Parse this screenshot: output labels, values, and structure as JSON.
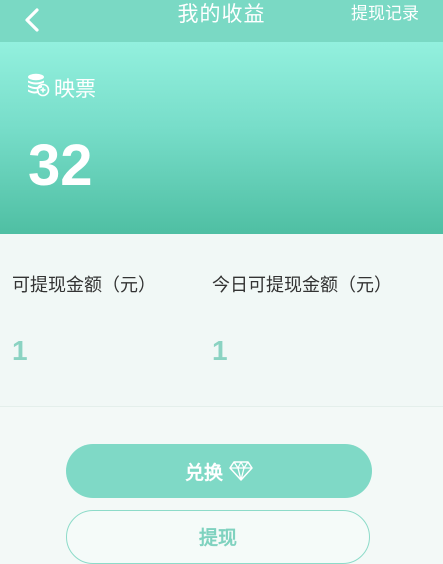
{
  "header": {
    "title": "我的收益",
    "history_label": "提现记录"
  },
  "balance": {
    "label": "映票",
    "value": "32",
    "icon": "coin-stack-icon"
  },
  "stats": [
    {
      "label": "可提现金额（元）",
      "value": "1"
    },
    {
      "label": "今日可提现金额（元）",
      "value": "1"
    }
  ],
  "actions": {
    "exchange_label": "兑换",
    "exchange_icon": "diamond-icon",
    "withdraw_label": "提现"
  },
  "colors": {
    "header_bg": "#7ad9c4",
    "banner_top": "#93f0de",
    "banner_bottom": "#4fbfa3",
    "accent": "#7fd9c6",
    "value_text": "#8bd3c2"
  }
}
